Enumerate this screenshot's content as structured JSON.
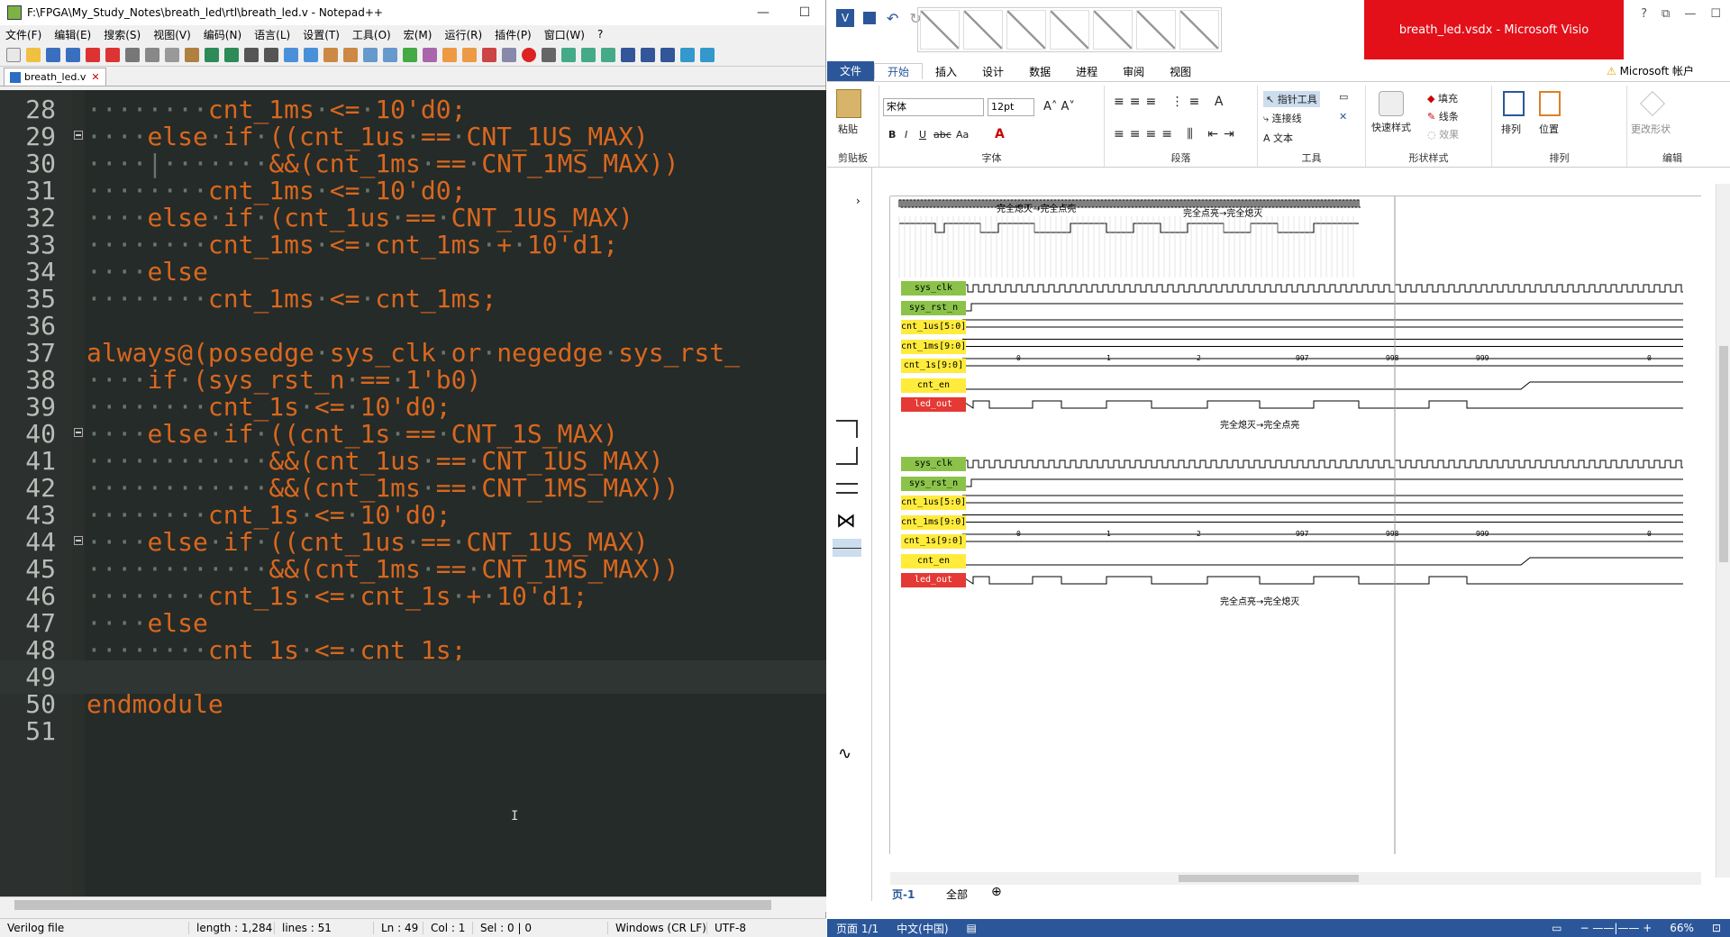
{
  "notepad": {
    "title": "F:\\FPGA\\My_Study_Notes\\breath_led\\rtl\\breath_led.v - Notepad++",
    "menu": [
      "文件(F)",
      "编辑(E)",
      "搜索(S)",
      "视图(V)",
      "编码(N)",
      "语言(L)",
      "设置(T)",
      "工具(O)",
      "宏(M)",
      "运行(R)",
      "插件(P)",
      "窗口(W)",
      "?"
    ],
    "tab": "breath_led.v",
    "lines": [
      {
        "n": "28",
        "code": "········cnt_1ms·<=·10'd0;"
      },
      {
        "n": "29",
        "code": "····else·if·((cnt_1us·==·CNT_1US_MAX)",
        "fold": true
      },
      {
        "n": "30",
        "code": "····|·······&&(cnt_1ms·==·CNT_1MS_MAX))"
      },
      {
        "n": "31",
        "code": "········cnt_1ms·<=·10'd0;"
      },
      {
        "n": "32",
        "code": "····else·if·(cnt_1us·==·CNT_1US_MAX)"
      },
      {
        "n": "33",
        "code": "········cnt_1ms·<=·cnt_1ms·+·10'd1;"
      },
      {
        "n": "34",
        "code": "····else"
      },
      {
        "n": "35",
        "code": "········cnt_1ms·<=·cnt_1ms;"
      },
      {
        "n": "36",
        "code": ""
      },
      {
        "n": "37",
        "code": "always@(posedge·sys_clk·or·negedge·sys_rst_"
      },
      {
        "n": "38",
        "code": "····if·(sys_rst_n·==·1'b0)"
      },
      {
        "n": "39",
        "code": "········cnt_1s·<=·10'd0;"
      },
      {
        "n": "40",
        "code": "····else·if·((cnt_1s·==·CNT_1S_MAX)",
        "fold": true
      },
      {
        "n": "41",
        "code": "············&&(cnt_1us·==·CNT_1US_MAX)"
      },
      {
        "n": "42",
        "code": "············&&(cnt_1ms·==·CNT_1MS_MAX))"
      },
      {
        "n": "43",
        "code": "········cnt_1s·<=·10'd0;"
      },
      {
        "n": "44",
        "code": "····else·if·((cnt_1us·==·CNT_1US_MAX)",
        "fold": true
      },
      {
        "n": "45",
        "code": "············&&(cnt_1ms·==·CNT_1MS_MAX))"
      },
      {
        "n": "46",
        "code": "········cnt_1s·<=·cnt_1s·+·10'd1;"
      },
      {
        "n": "47",
        "code": "····else"
      },
      {
        "n": "48",
        "code": "········cnt_1s·<=·cnt_1s;"
      },
      {
        "n": "49",
        "code": "",
        "current": true
      },
      {
        "n": "50",
        "code": "endmodule"
      },
      {
        "n": "51",
        "code": ""
      }
    ],
    "status": {
      "lang": "Verilog file",
      "length": "length : 1,284",
      "lines": "lines : 51",
      "ln": "Ln : 49",
      "col": "Col : 1",
      "sel": "Sel : 0 | 0",
      "eol": "Windows (CR LF)",
      "enc": "UTF-8"
    }
  },
  "visio": {
    "title": "breath_led.vsdx - Microsoft Visio",
    "tabs": [
      "文件",
      "开始",
      "插入",
      "设计",
      "数据",
      "进程",
      "审阅",
      "视图"
    ],
    "account": "Microsoft 帐户",
    "ribbon": {
      "paste": "粘贴",
      "clipboard": "剪贴板",
      "font_name": "宋体",
      "font_size": "12pt",
      "font_group": "字体",
      "para_group": "段落",
      "pointer": "指针工具",
      "connector": "连接线",
      "text": "文本",
      "tools_group": "工具",
      "quick_style": "快速样式",
      "fill": "填充",
      "line": "线条",
      "effect": "效果",
      "shape_style_group": "形状样式",
      "arrange": "排列",
      "position": "位置",
      "arrange_group": "排列",
      "change_shape": "更改形状",
      "edit_group": "编辑"
    },
    "signals_top": [
      {
        "name": "sys_clk",
        "color": "g"
      },
      {
        "name": "sys_rst_n",
        "color": "g"
      },
      {
        "name": "cnt_1us[5:0]",
        "color": "y"
      },
      {
        "name": "cnt_1ms[9:0]",
        "color": "y"
      },
      {
        "name": "cnt_1s[9:0]",
        "color": "y"
      },
      {
        "name": "cnt_en",
        "color": "y"
      },
      {
        "name": "led_out",
        "color": "r"
      }
    ],
    "signals_bottom": [
      {
        "name": "sys_clk",
        "color": "g"
      },
      {
        "name": "sys_rst_n",
        "color": "g"
      },
      {
        "name": "cnt_1us[5:0]",
        "color": "y"
      },
      {
        "name": "cnt_1ms[9:0]",
        "color": "y"
      },
      {
        "name": "cnt_1s[9:0]",
        "color": "y"
      },
      {
        "name": "cnt_en",
        "color": "y"
      },
      {
        "name": "led_out",
        "color": "r"
      }
    ],
    "annotations": {
      "top_a": "完全熄灭→完全点亮",
      "top_b": "完全点亮→完全熄灭",
      "mid": "完全熄灭→完全点亮",
      "bottom": "完全点亮→完全熄灭"
    },
    "cnt_1s_values": [
      "0",
      "1",
      "2",
      "997",
      "998",
      "999",
      "0"
    ],
    "page_tab": "页-1",
    "all_tab": "全部",
    "status": {
      "page": "页面 1/1",
      "lang": "中文(中国)",
      "zoom": "66%"
    }
  }
}
